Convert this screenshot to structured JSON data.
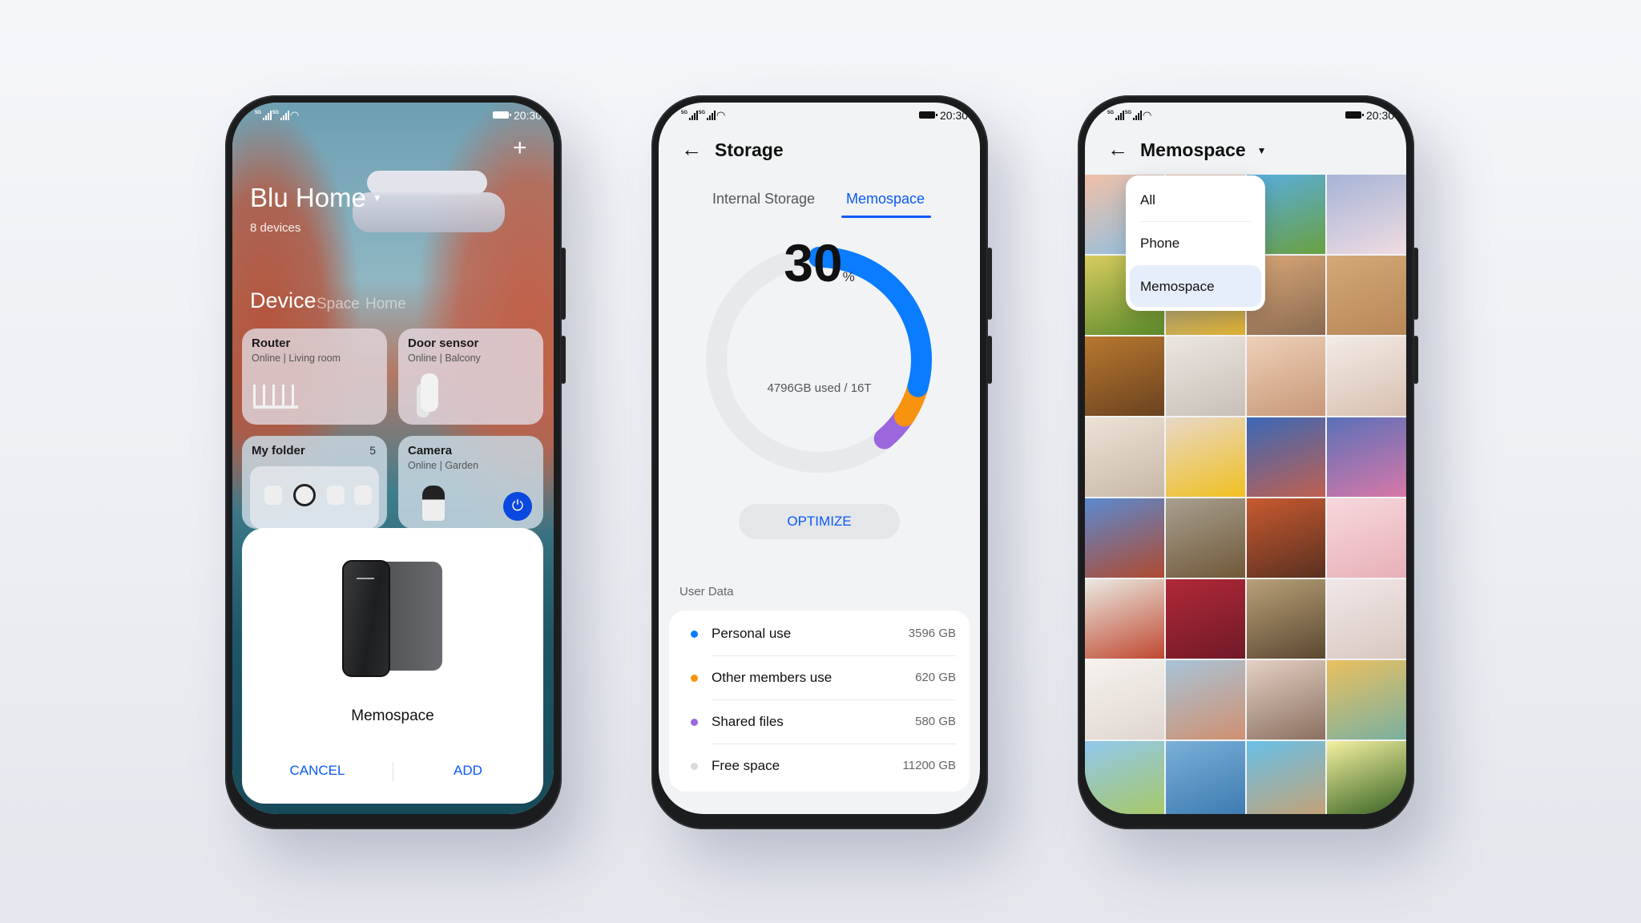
{
  "status_bar": {
    "network": "5G",
    "time": "20:30"
  },
  "home_app": {
    "title": "Blu Home",
    "device_count": "8 devices",
    "tabs": [
      {
        "label": "Device",
        "active": true
      },
      {
        "label": "Space",
        "active": false
      },
      {
        "label": "Home",
        "active": false
      }
    ],
    "cards": [
      {
        "name": "Router",
        "status": "Online | Living room"
      },
      {
        "name": "Door sensor",
        "status": "Online | Balcony"
      },
      {
        "name": "My folder",
        "count": "5"
      },
      {
        "name": "Camera",
        "status": "Online | Garden"
      }
    ],
    "dialog": {
      "device_name": "Memospace",
      "cancel_label": "CANCEL",
      "add_label": "ADD"
    }
  },
  "storage_app": {
    "title": "Storage",
    "tabs": [
      {
        "label": "Internal Storage",
        "active": false
      },
      {
        "label": "Memospace",
        "active": true
      }
    ],
    "usage_percent": "30",
    "percent_sign": "%",
    "usage_summary": "4796GB used / 16T",
    "optimize_label": "OPTIMIZE",
    "section_title": "User Data",
    "total_gb": 16000,
    "items": [
      {
        "label": "Personal use",
        "value": "3596 GB",
        "gb": 3596,
        "color": "#0a7cff"
      },
      {
        "label": "Other members use",
        "value": "620 GB",
        "gb": 620,
        "color": "#f7930e"
      },
      {
        "label": "Shared files",
        "value": "580 GB",
        "gb": 580,
        "color": "#9b67dd"
      },
      {
        "label": "Free space",
        "value": "11200 GB",
        "gb": 11200,
        "color": "#d9dadd"
      }
    ]
  },
  "gallery_app": {
    "title": "Memospace",
    "filter_options": [
      {
        "label": "All",
        "selected": false
      },
      {
        "label": "Phone",
        "selected": false
      },
      {
        "label": "Memospace",
        "selected": true
      }
    ]
  },
  "colors": {
    "accent": "#0a59f7",
    "background": "#f1f3f5"
  }
}
